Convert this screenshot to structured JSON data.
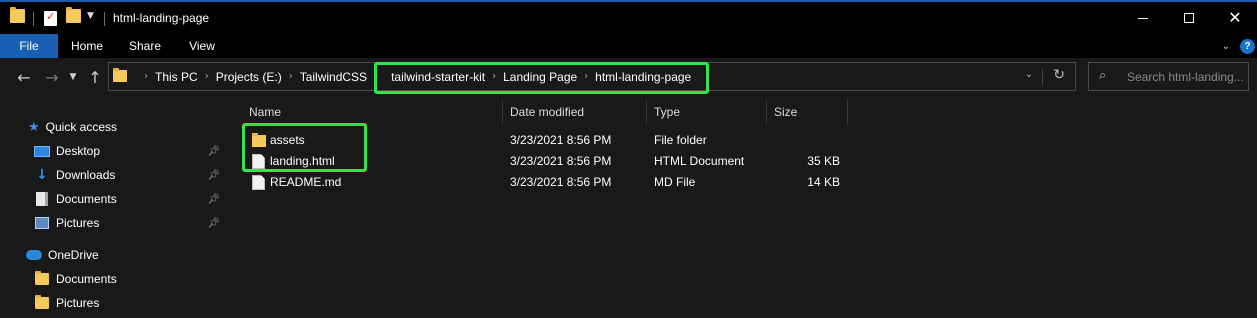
{
  "window": {
    "title": "html-landing-page"
  },
  "ribbon": {
    "tabs": [
      "File",
      "Home",
      "Share",
      "View"
    ]
  },
  "address": {
    "crumbs": [
      "This PC",
      "Projects (E:)",
      "TailwindCSS",
      "tailwind-starter-kit",
      "Landing Page",
      "html-landing-page"
    ]
  },
  "search": {
    "placeholder": "Search html-landing..."
  },
  "nav_pane": {
    "items": [
      {
        "label": "Quick access",
        "icon": "star-icon"
      },
      {
        "label": "Desktop",
        "icon": "desktop-icon",
        "pinned": true
      },
      {
        "label": "Downloads",
        "icon": "download-icon",
        "pinned": true
      },
      {
        "label": "Documents",
        "icon": "documents-icon",
        "pinned": true
      },
      {
        "label": "Pictures",
        "icon": "pictures-icon",
        "pinned": true
      },
      {
        "label": "OneDrive",
        "icon": "cloud-icon"
      },
      {
        "label": "Documents",
        "icon": "folder-icon"
      },
      {
        "label": "Pictures",
        "icon": "folder-icon"
      }
    ]
  },
  "columns": {
    "name": "Name",
    "date": "Date modified",
    "type": "Type",
    "size": "Size"
  },
  "files": [
    {
      "name": "assets",
      "date": "3/23/2021 8:56 PM",
      "type": "File folder",
      "size": "",
      "icon": "folder-icon"
    },
    {
      "name": "landing.html",
      "date": "3/23/2021 8:56 PM",
      "type": "HTML Document",
      "size": "35 KB",
      "icon": "file-icon"
    },
    {
      "name": "README.md",
      "date": "3/23/2021 8:56 PM",
      "type": "MD File",
      "size": "14 KB",
      "icon": "file-icon"
    }
  ],
  "colors": {
    "highlight": "#2fe54a",
    "file_tab": "#1a5fb4",
    "folder": "#f5c95b",
    "accent": "#1f5aa8"
  }
}
